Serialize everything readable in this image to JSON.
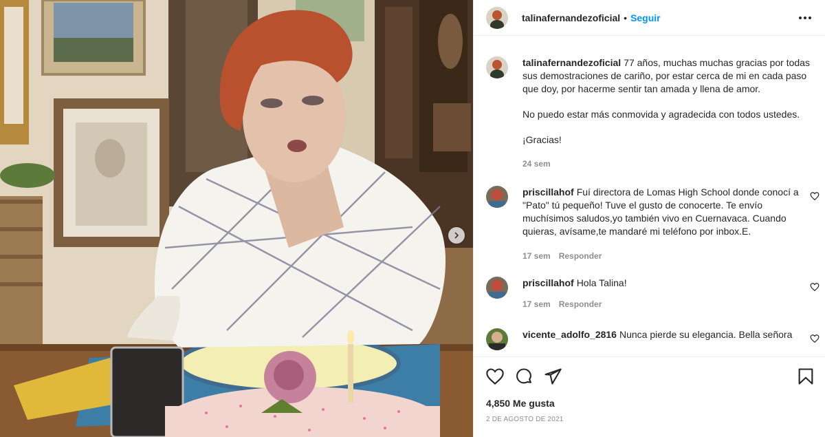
{
  "post": {
    "username": "talinafernandezoficial",
    "separator": "•",
    "follow_label": "Seguir",
    "more_icon": "more-options-icon",
    "caption_lines": [
      "77 años, muchas muchas gracias por todas sus demostraciones de cariño, por estar cerca de mi en cada paso que doy, por hacerme sentir tan amada y llena de amor.",
      "No puedo estar más conmovida y agradecida con todos ustedes.",
      "¡Gracias!"
    ],
    "caption_time": "24 sem",
    "likes": "4,850 Me gusta",
    "date": "2 de agosto de 2021"
  },
  "comments": [
    {
      "user": "priscillahof",
      "text": "Fuí directora de Lomas High School donde conocí a \"Pato\" tú pequeño! Tuve el gusto de conocerte. Te envío muchísimos saludos,yo también vivo en Cuernavaca. Cuando quieras, avísame,te mandaré mi teléfono por inbox.E.",
      "time": "17 sem",
      "reply": "Responder"
    },
    {
      "user": "priscillahof",
      "text": "Hola Talina!",
      "time": "17 sem",
      "reply": "Responder"
    },
    {
      "user": "vicente_adolfo_2816",
      "text": "Nunca pierde su elegancia. Bella señora",
      "time": "",
      "reply": ""
    }
  ],
  "icons": {
    "like": "heart-icon",
    "comment": "comment-icon",
    "share": "share-icon",
    "save": "bookmark-icon",
    "carousel_next": "chevron-right-icon"
  },
  "colors": {
    "accent": "#0095f6",
    "text": "#262626",
    "muted": "#8e8e8e",
    "divider": "#efefef"
  }
}
